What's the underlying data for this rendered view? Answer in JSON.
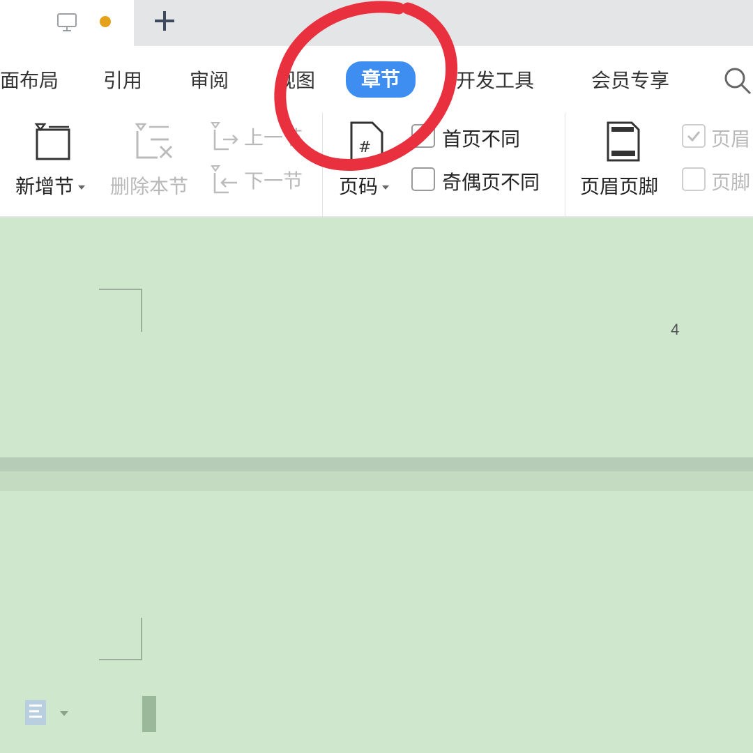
{
  "titlebar": {
    "icons": [
      "monitor-icon",
      "unsaved-dot",
      "plus-icon"
    ],
    "colors": {
      "unsaved_dot": "#e3a21a"
    }
  },
  "ribbon_tabs": [
    {
      "label": "面布局"
    },
    {
      "label": "引用"
    },
    {
      "label": "审阅"
    },
    {
      "label": "视图"
    },
    {
      "label": "章节",
      "active": true
    },
    {
      "label": "开发工具"
    },
    {
      "label": "会员专享"
    }
  ],
  "accent_color": "#3d8ef0",
  "section_tools": {
    "new_section": "新增节",
    "delete_section": "删除本节",
    "prev_section": "上一节",
    "next_section": "下一节",
    "page_number": "页码",
    "first_page_different": "首页不同",
    "odd_even_different": "奇偶页不同",
    "header_footer": "页眉页脚",
    "header_partial": "页眉",
    "footer_partial": "页脚"
  },
  "checkboxes": {
    "first_page_different": false,
    "odd_even_different": false,
    "header_partial": true,
    "footer_partial": false
  },
  "document": {
    "page_number_text": "4",
    "background_color": "#cfe8cd"
  },
  "annotation": {
    "shape": "hand-drawn circle around 章节 tab",
    "color": "#e8303f"
  }
}
